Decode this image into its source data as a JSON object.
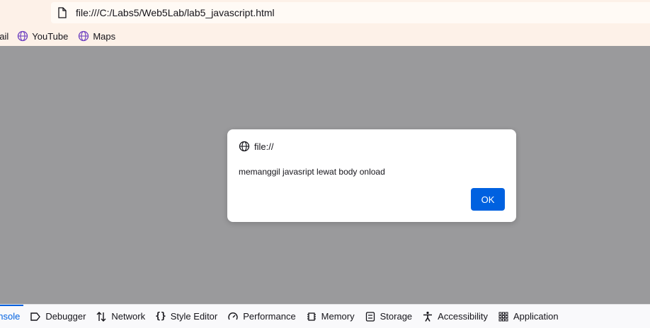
{
  "browser": {
    "url": "file:///C:/Labs5/Web5Lab/lab5_javascript.html",
    "bookmarks": [
      {
        "label": "nail",
        "icon": "globe-icon"
      },
      {
        "label": "YouTube",
        "icon": "globe-icon"
      },
      {
        "label": "Maps",
        "icon": "globe-icon"
      }
    ]
  },
  "dialog": {
    "origin": "file://",
    "message": "memanggil javasript lewat body onload",
    "ok_label": "OK"
  },
  "devtools": {
    "tabs": [
      {
        "label": "onsole",
        "icon": "console-icon",
        "active": true
      },
      {
        "label": "Debugger",
        "icon": "debugger-icon"
      },
      {
        "label": "Network",
        "icon": "network-icon"
      },
      {
        "label": "Style Editor",
        "icon": "braces-icon"
      },
      {
        "label": "Performance",
        "icon": "gauge-icon"
      },
      {
        "label": "Memory",
        "icon": "chip-icon"
      },
      {
        "label": "Storage",
        "icon": "storage-icon"
      },
      {
        "label": "Accessibility",
        "icon": "accessibility-icon"
      },
      {
        "label": "Application",
        "icon": "grid-icon"
      }
    ],
    "accent": "#0061e0"
  }
}
